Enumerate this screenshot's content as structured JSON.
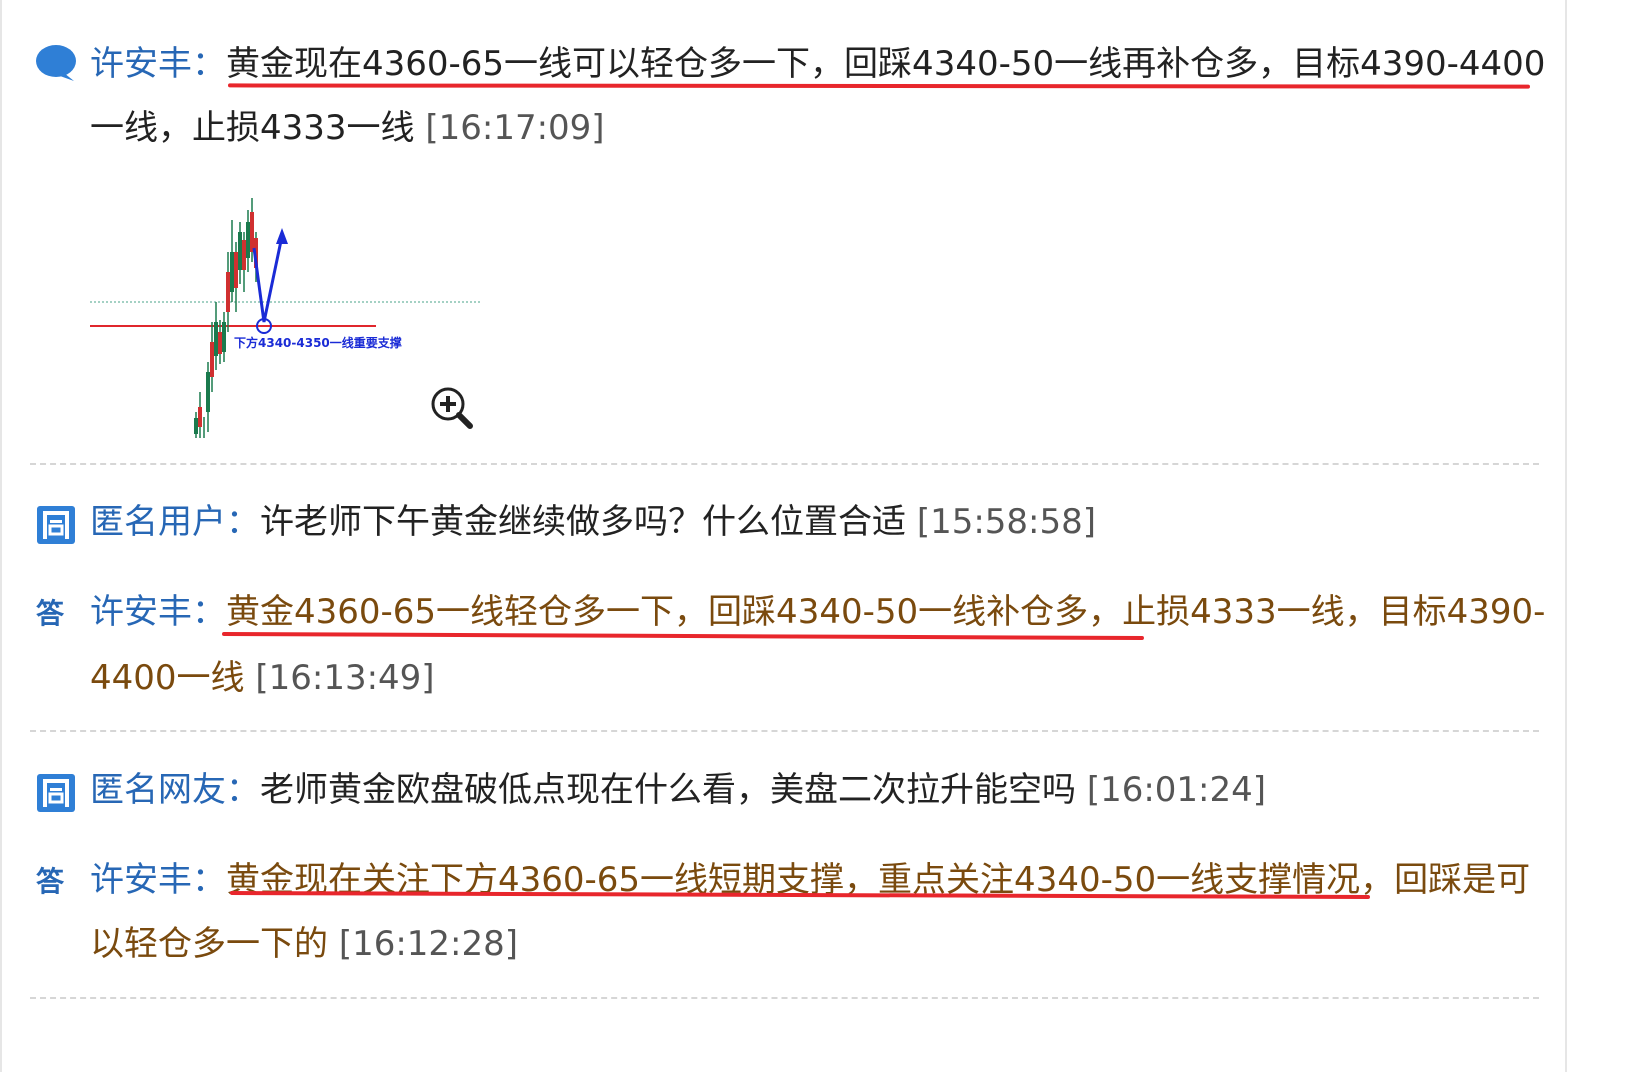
{
  "messages": [
    {
      "author": "许安丰",
      "colon": "：",
      "text_underlined": "黄金现在4360-65一线可以轻仓多一下，回踩4340-50一线再补仓多，目标4390-4400",
      "text_rest": "一线，止损4333一线",
      "time": "[16:17:09]",
      "icon": "speech-bubble-icon",
      "attachment": {
        "type": "chart-image",
        "support_label": "下方4340-4350一线重要支撑",
        "zoom_icon": "zoom-in-icon"
      }
    }
  ],
  "qa": [
    {
      "question": {
        "icon": "question-icon",
        "asker": "匿名用户",
        "colon": "：",
        "text": "许老师下午黄金继续做多吗？什么位置合适",
        "time": "[15:58:58]"
      },
      "answer": {
        "icon_label": "答",
        "answerer": "许安丰",
        "colon": "：",
        "text_underlined": "黄金4360-65一线轻仓多一下，回踩4340-50一线补仓多，止损4333一线",
        "text_tail_line1": "，目标4390-",
        "text_line2": "4400一线",
        "time": "[16:13:49]"
      }
    },
    {
      "question": {
        "icon": "question-icon",
        "asker": "匿名网友",
        "colon": "：",
        "text": "老师黄金欧盘破低点现在什么看，美盘二次拉升能空吗",
        "time": "[16:01:24]"
      },
      "answer": {
        "icon_label": "答",
        "answerer": "许安丰",
        "colon": "：",
        "text_underlined": "黄金现在关注下方4360-65一线短期支撑，重点关注4340-50一线支撑情况，",
        "text_tail_line1": "回踩是可",
        "text_line2": "以轻仓多一下的",
        "time": "[16:12:28]"
      }
    }
  ],
  "colors": {
    "name_blue": "#2767b5",
    "answer_brown": "#7a4a0e",
    "underline_red": "#e8262c",
    "separator": "#d6d6d6"
  }
}
